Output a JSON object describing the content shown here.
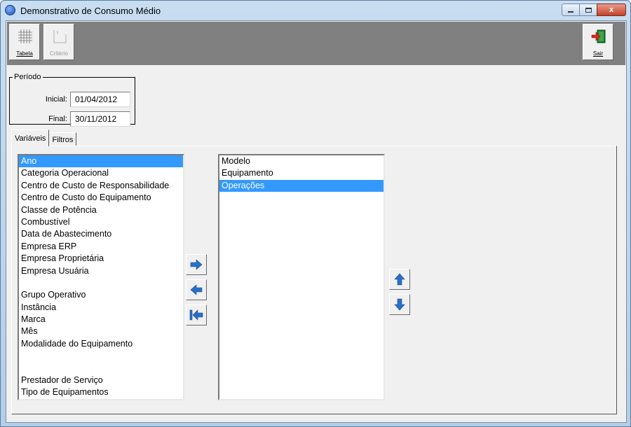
{
  "window": {
    "title": "Demonstrativo de Consumo Médio",
    "close_glyph": "x"
  },
  "toolbar": {
    "tabela_label": "Tabela",
    "criterio_label": "Critério",
    "sair_label": "Sair"
  },
  "periodo": {
    "legend": "Período",
    "inicial_label": "Inicial:",
    "inicial_value": "01/04/2012",
    "final_label": "Final:",
    "final_value": "30/11/2012"
  },
  "tabs": [
    {
      "label": "Variáveis",
      "active": true
    },
    {
      "label": "Filtros",
      "active": false
    }
  ],
  "available_list": {
    "items": [
      "Ano",
      "Categoria Operacional",
      "Centro de Custo de Responsabilidade",
      "Centro de Custo do Equipamento",
      "Classe de Potência",
      "Combustível",
      "Data de Abastecimento",
      "Empresa ERP",
      "Empresa Proprietária",
      "Empresa Usuária",
      "",
      "Grupo Operativo",
      "Instância",
      "Marca",
      "Mês",
      "Modalidade do Equipamento",
      "",
      "",
      "Prestador de Serviço",
      "Tipo de Equipamentos"
    ],
    "selected": "Ano"
  },
  "selected_list": {
    "items": [
      "Modelo",
      "Equipamento",
      "Operações"
    ],
    "selected": "Operações"
  },
  "colors": {
    "selection": "#3399ff",
    "arrow": "#2a6fc9",
    "toolbar_bg": "#808080"
  },
  "icons": {
    "add": "arrow-right-icon",
    "remove": "arrow-left-icon",
    "remove_all": "arrow-left-bar-icon",
    "move_up": "arrow-up-icon",
    "move_down": "arrow-down-icon"
  }
}
